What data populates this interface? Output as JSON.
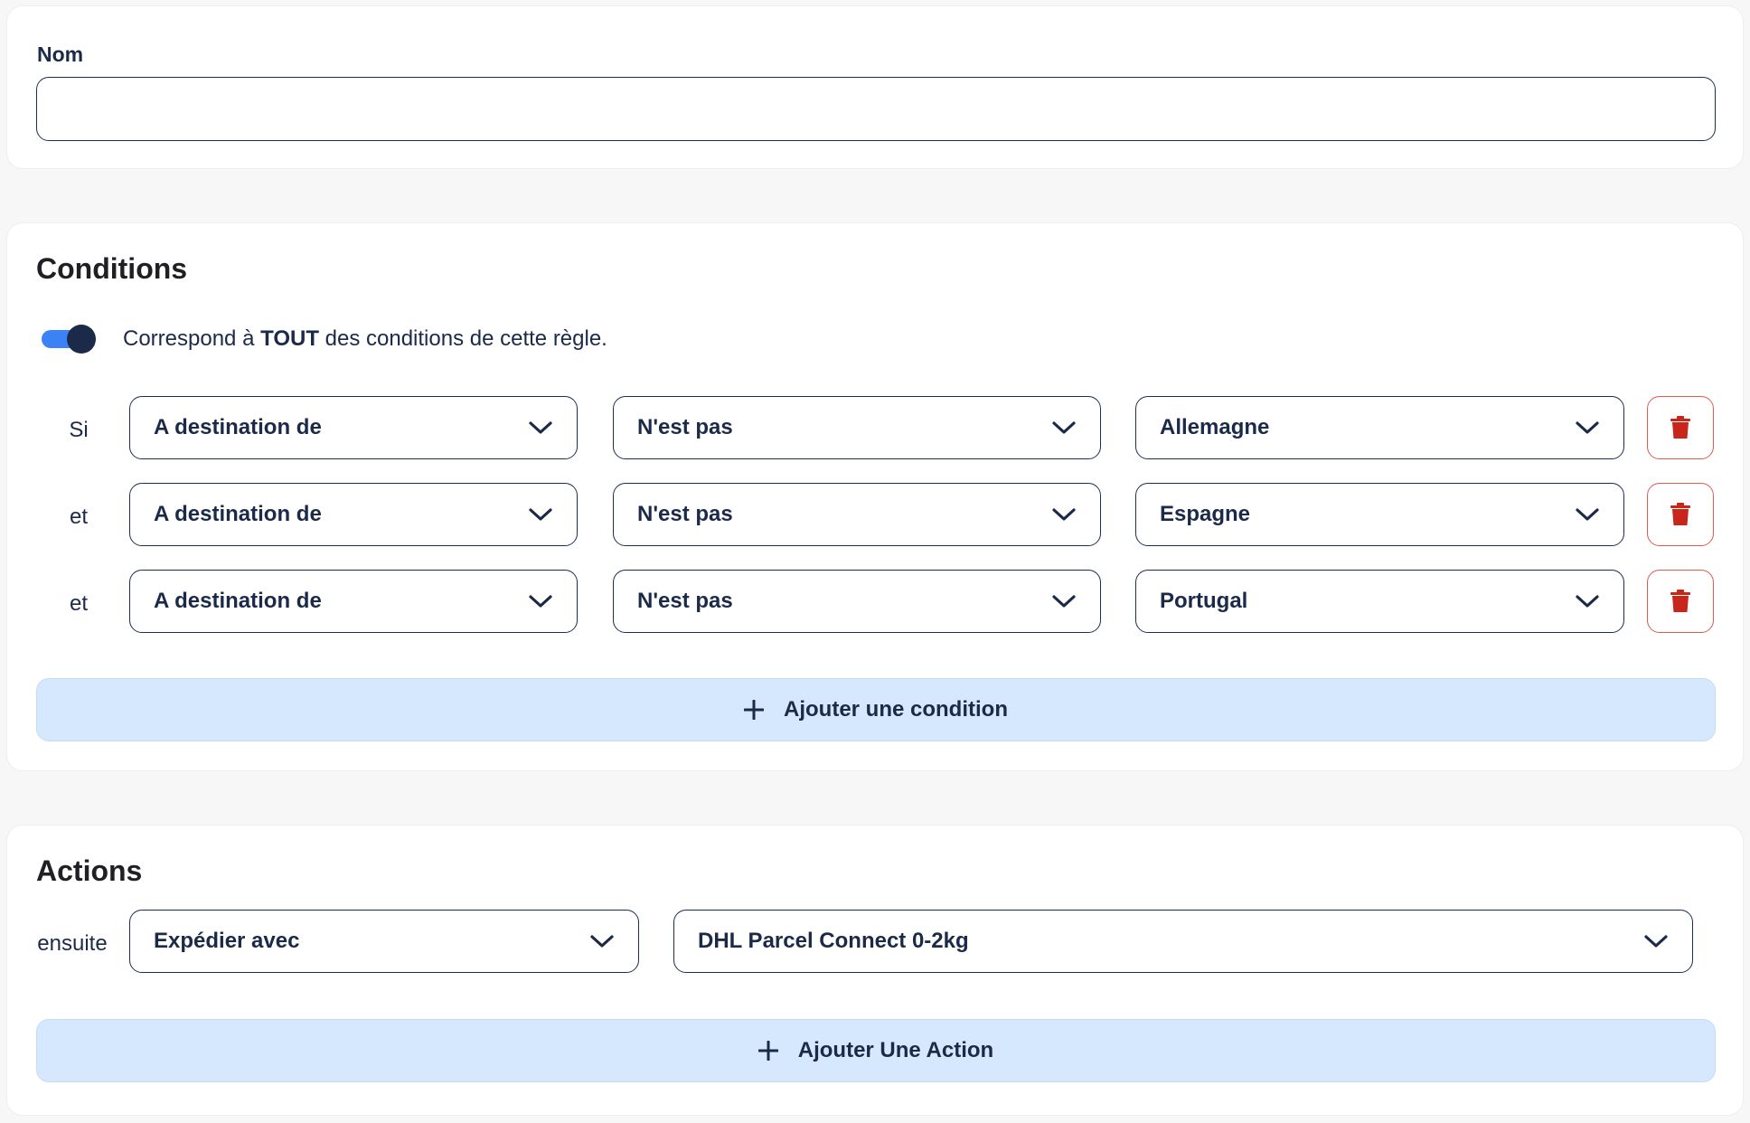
{
  "nom": {
    "label": "Nom",
    "value": "",
    "placeholder": ""
  },
  "conditions": {
    "title": "Conditions",
    "toggle": {
      "on": true,
      "text_before": "Correspond à ",
      "text_bold": "TOUT",
      "text_after": " des conditions de cette règle."
    },
    "rows": [
      {
        "prefix": "Si",
        "field": "A destination de",
        "operator": "N'est pas",
        "value": "Allemagne"
      },
      {
        "prefix": "et",
        "field": "A destination de",
        "operator": "N'est pas",
        "value": "Espagne"
      },
      {
        "prefix": "et",
        "field": "A destination de",
        "operator": "N'est pas",
        "value": "Portugal"
      }
    ],
    "add_label": "Ajouter une condition"
  },
  "actions": {
    "title": "Actions",
    "rows": [
      {
        "prefix": "ensuite",
        "action": "Expédier avec",
        "value": "DHL Parcel Connect 0-2kg"
      }
    ],
    "add_label": "Ajouter Une Action"
  },
  "colors": {
    "text": "#1c2a4a",
    "toggle_track": "#3b82f6",
    "toggle_knob": "#1c2a4a",
    "delete": "#c8261b",
    "add_button_bg": "#d6e8fd"
  },
  "icons": {
    "chevron": "chevron-down-icon",
    "delete": "trash-icon",
    "add": "plus-icon"
  }
}
